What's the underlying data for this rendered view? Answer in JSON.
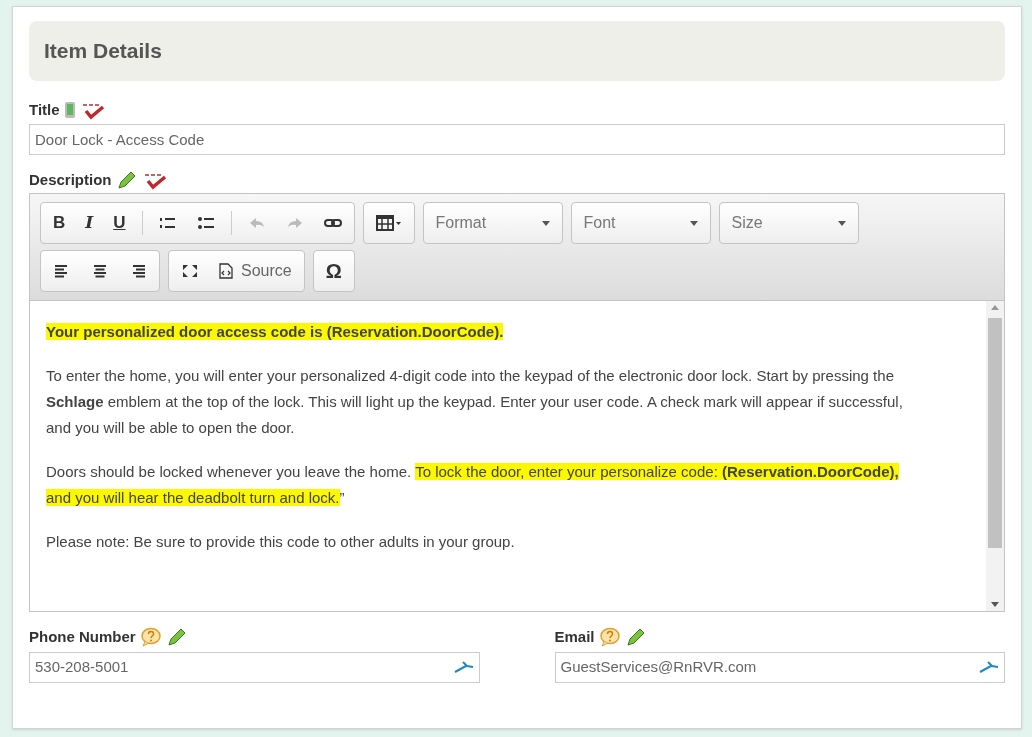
{
  "header": {
    "title": "Item Details"
  },
  "title_field": {
    "label": "Title",
    "value": "Door Lock - Access Code"
  },
  "description": {
    "label": "Description",
    "toolbar": {
      "format_buttons": [
        "B",
        "I",
        "U"
      ],
      "undo_disabled": true,
      "redo_disabled": true,
      "dropdowns": [
        "Format",
        "Font",
        "Size"
      ],
      "source": "Source",
      "special_char": "Ω"
    },
    "paragraphs": [
      [
        {
          "text": "**Your personalized door access code is (Reservation.DoorCode).**",
          "highlighted": true
        }
      ],
      [
        {
          "text": "To enter the home, you will enter your personalized 4-digit code into the keypad of the electronic door lock. Start by pressing the **Schlage** emblem at the top of the lock. This will light up the keypad.  Enter your user code. A check mark will appear if successful, and you will be able to open the door.",
          "highlighted": false
        }
      ],
      [
        {
          "text": "Doors should be locked whenever you leave the home. ",
          "highlighted": false
        },
        {
          "text": "To lock the door, enter your personalize code: **(Reservation.DoorCode),** and you will hear the deadbolt turn and lock.",
          "highlighted": true
        },
        {
          "text": "”",
          "highlighted": false
        }
      ],
      [
        {
          "text": "Please note: Be sure to provide this code to other adults in your group.",
          "highlighted": false
        }
      ]
    ]
  },
  "contact_fields": [
    {
      "label": "Phone Number",
      "value": "530-208-5001"
    },
    {
      "label": "Email",
      "value": "GuestServices@RnRVR.com"
    }
  ]
}
